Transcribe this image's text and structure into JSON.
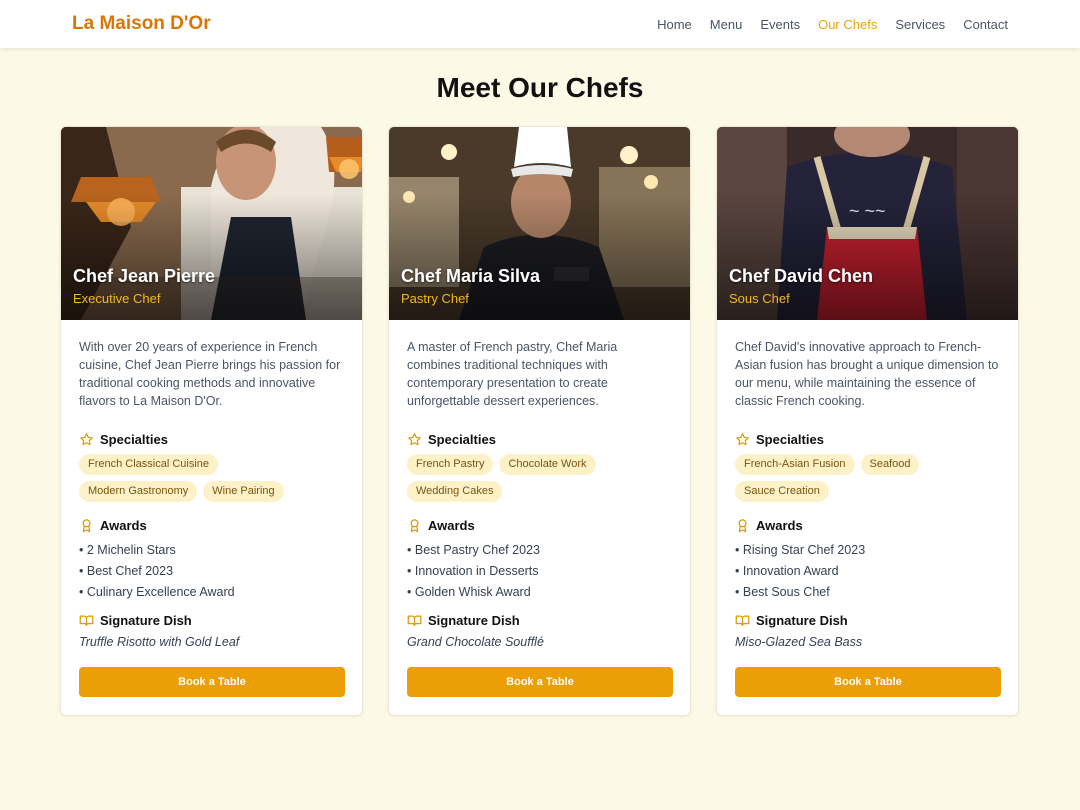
{
  "header": {
    "brand": "La Maison D'Or",
    "nav": [
      {
        "label": "Home"
      },
      {
        "label": "Menu"
      },
      {
        "label": "Events"
      },
      {
        "label": "Our Chefs"
      },
      {
        "label": "Services"
      },
      {
        "label": "Contact"
      }
    ]
  },
  "page": {
    "title": "Meet Our Chefs"
  },
  "labels": {
    "specialties": "Specialties",
    "awards": "Awards",
    "signature": "Signature Dish",
    "book": "Book a Table"
  },
  "chefs": [
    {
      "name": "Chef Jean Pierre",
      "role": "Executive Chef",
      "description": "With over 20 years of experience in French cuisine, Chef Jean Pierre brings his passion for traditional cooking methods and innovative flavors to La Maison D'Or.",
      "specialties": [
        "French Classical Cuisine",
        "Modern Gastronomy",
        "Wine Pairing"
      ],
      "awards": [
        "2 Michelin Stars",
        "Best Chef 2023",
        "Culinary Excellence Award"
      ],
      "signature_dish": "Truffle Risotto with Gold Leaf"
    },
    {
      "name": "Chef Maria Silva",
      "role": "Pastry Chef",
      "description": "A master of French pastry, Chef Maria combines traditional techniques with contemporary presentation to create unforgettable dessert experiences.",
      "specialties": [
        "French Pastry",
        "Chocolate Work",
        "Wedding Cakes"
      ],
      "awards": [
        "Best Pastry Chef 2023",
        "Innovation in Desserts",
        "Golden Whisk Award"
      ],
      "signature_dish": "Grand Chocolate Soufflé"
    },
    {
      "name": "Chef David Chen",
      "role": "Sous Chef",
      "description": "Chef David's innovative approach to French-Asian fusion has brought a unique dimension to our menu, while maintaining the essence of classic French cooking.",
      "specialties": [
        "French-Asian Fusion",
        "Seafood",
        "Sauce Creation"
      ],
      "awards": [
        "Rising Star Chef 2023",
        "Innovation Award",
        "Best Sous Chef"
      ],
      "signature_dish": "Miso-Glazed Sea Bass"
    }
  ],
  "colors": {
    "brand": "#d97706",
    "accent": "#eb9e06",
    "role": "#f5b821",
    "tag_bg": "#fdf1c7",
    "page_bg": "#fdf9e7"
  }
}
